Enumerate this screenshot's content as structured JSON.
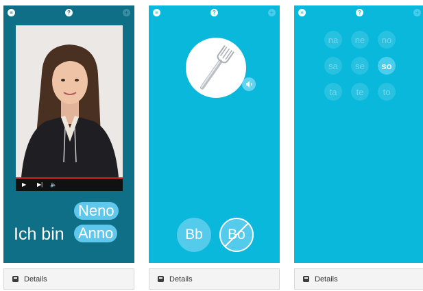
{
  "cards": [
    {
      "topbar": {
        "left_icon": "list-icon",
        "help_icon": "help-icon",
        "right_icon": "plus-icon"
      },
      "video": {
        "progress": 1.0,
        "play_icon": "play-icon",
        "next_icon": "skip-icon",
        "volume_icon": "volume-icon"
      },
      "options": [
        "Neno",
        "Anno"
      ],
      "prefix": "Ich bin",
      "details_label": "Details"
    },
    {
      "topbar": {
        "left_icon": "list-icon",
        "help_icon": "help-icon",
        "right_icon": "plus-icon"
      },
      "image_icon": "fork-icon",
      "speaker_icon": "speaker-icon",
      "options": [
        "Bb",
        "Bo"
      ],
      "details_label": "Details"
    },
    {
      "topbar": {
        "left_icon": "list-icon",
        "help_icon": "help-icon",
        "right_icon": "plus-icon"
      },
      "syllables": [
        [
          "na",
          "ne",
          "no"
        ],
        [
          "sa",
          "se",
          "so"
        ],
        [
          "ta",
          "te",
          "to"
        ]
      ],
      "selected": "so",
      "details_label": "Details"
    }
  ],
  "colors": {
    "teal_dark": "#0e6f86",
    "cyan": "#09b8da",
    "pill": "#5fc7ec",
    "white": "#ffffff"
  }
}
